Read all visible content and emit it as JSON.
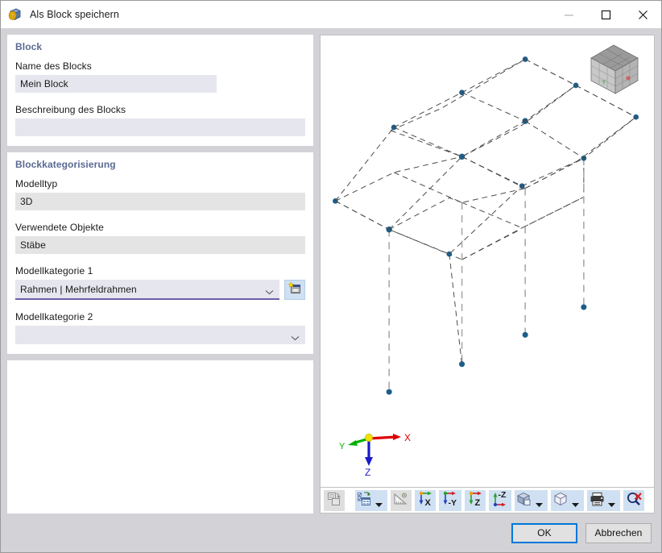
{
  "window": {
    "title": "Als Block speichern",
    "icon": "save-block-icon",
    "controls": {
      "minimize": "minimize-icon",
      "maximize": "maximize-icon",
      "close": "close-icon"
    }
  },
  "block_section": {
    "title": "Block",
    "name_label": "Name des Blocks",
    "name_value": "Mein Block",
    "description_label": "Beschreibung des Blocks",
    "description_value": "",
    "description_placeholder": ""
  },
  "category_section": {
    "title": "Blockkategorisierung",
    "model_type_label": "Modelltyp",
    "model_type_value": "3D",
    "used_objects_label": "Verwendete Objekte",
    "used_objects_value": "Stäbe",
    "category1_label": "Modellkategorie 1",
    "category1_value": "Rahmen | Mehrfeldrahmen",
    "category1_new_button": "new-category-icon",
    "category2_label": "Modellkategorie 2",
    "category2_value": ""
  },
  "viewport": {
    "navigation_cube": "view-cube-icon",
    "axes": {
      "x_label": "X",
      "y_label": "Y",
      "z_label": "Z",
      "x_color": "#e00000",
      "y_color": "#00b000",
      "z_color": "#1a1ac8",
      "origin_color": "#f2e000"
    },
    "model": {
      "node_color": "#1b5e8c",
      "line_color": "#4a4a4a",
      "column_color": "#a8a8a8"
    }
  },
  "toolbar": {
    "buttons": [
      {
        "name": "snapshot-button",
        "icon": "snapshot-icon",
        "disabled": true,
        "dropdown": false
      },
      {
        "name": "display-properties-button",
        "icon": "display-properties-icon",
        "disabled": false,
        "dropdown": true
      },
      {
        "name": "measure-button",
        "icon": "measure-icon",
        "disabled": true,
        "dropdown": false
      },
      {
        "name": "view-in-x-button",
        "icon": "view-x-icon",
        "label": "X",
        "disabled": false,
        "dropdown": false
      },
      {
        "name": "view-in-negative-y-button",
        "icon": "view-negative-y-icon",
        "label": "-Y",
        "disabled": false,
        "dropdown": false
      },
      {
        "name": "view-in-z-button",
        "icon": "view-z-icon",
        "label": "Z",
        "disabled": false,
        "dropdown": false
      },
      {
        "name": "view-in-negative-z-button",
        "icon": "view-negative-z-icon",
        "label": "-Z",
        "disabled": false,
        "dropdown": false
      },
      {
        "name": "render-mode-button",
        "icon": "render-mode-icon",
        "disabled": false,
        "dropdown": true
      },
      {
        "name": "wireframe-button",
        "icon": "wireframe-cube-icon",
        "disabled": false,
        "dropdown": true
      },
      {
        "name": "print-button",
        "icon": "printer-icon",
        "disabled": false,
        "dropdown": true
      },
      {
        "name": "reset-zoom-button",
        "icon": "zoom-reset-icon",
        "disabled": false,
        "dropdown": false
      }
    ]
  },
  "footer": {
    "ok_label": "OK",
    "cancel_label": "Abbrechen"
  },
  "colors": {
    "accent": "#0078d7",
    "section_header": "#5a6a93",
    "focus_underline": "#6b5fa8",
    "input_bg": "#e6e6ee",
    "readonly_bg": "#e4e4e4",
    "dialog_bg": "#d2d2d7",
    "toolbar_btn_bg": "#cfe0f2"
  }
}
